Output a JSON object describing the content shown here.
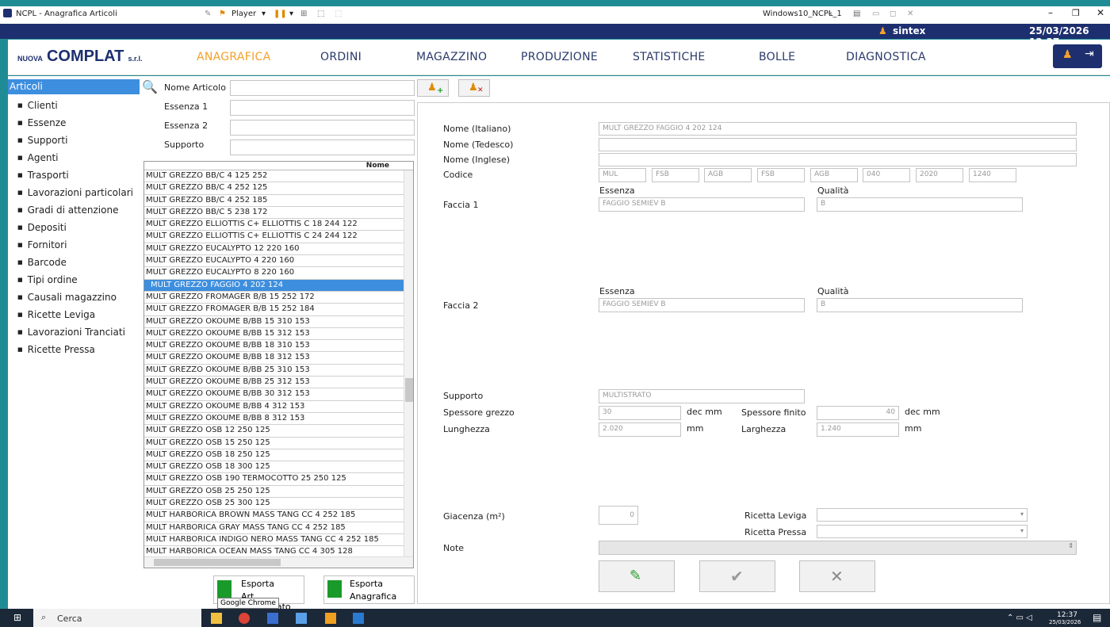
{
  "window": {
    "title": "NCPL - Anagrafica Articoli",
    "vm_name": "Windows10_NCPL_1"
  },
  "player": {
    "label": "Player"
  },
  "header": {
    "user": "sintex",
    "datetime": "25/03/2026 12:37"
  },
  "logo": {
    "prefix": "NUOVA",
    "main": "COMPLAT",
    "suffix": "s.r.l."
  },
  "nav": [
    {
      "label": "ANAGRAFICA",
      "active": true
    },
    {
      "label": "ORDINI"
    },
    {
      "label": "MAGAZZINO"
    },
    {
      "label": "PRODUZIONE"
    },
    {
      "label": "STATISTICHE"
    },
    {
      "label": "BOLLE"
    },
    {
      "label": "DIAGNOSTICA"
    }
  ],
  "sidebar": {
    "active": "Articoli",
    "items": [
      "Clienti",
      "Essenze",
      "Supporti",
      "Agenti",
      "Trasporti",
      "Lavorazioni particolari",
      "Gradi di attenzione",
      "Depositi",
      "Fornitori",
      "Barcode",
      "Tipi ordine",
      "Causali magazzino",
      "Ricette Leviga",
      "Lavorazioni Tranciati",
      "Ricette Pressa"
    ]
  },
  "filters": {
    "nome_articolo": "Nome Articolo",
    "essenza1": "Essenza 1",
    "essenza2": "Essenza 2",
    "supporto": "Supporto"
  },
  "list": {
    "header": "Nome",
    "selected": "MULT GREZZO FAGGIO 4 202 124",
    "rows": [
      "MULT GREZZO BB/C 4 125 252",
      "MULT GREZZO BB/C 4 252 125",
      "MULT GREZZO BB/C 4 252 185",
      "MULT GREZZO BB/C 5 238 172",
      "MULT GREZZO ELLIOTTIS C+ ELLIOTTIS C 18 244 122",
      "MULT GREZZO ELLIOTTIS C+ ELLIOTTIS C 24 244 122",
      "MULT GREZZO EUCALYPTO 12 220 160",
      "MULT GREZZO EUCALYPTO 4 220 160",
      "MULT GREZZO EUCALYPTO 8 220 160",
      "MULT GREZZO FAGGIO 4 202 124",
      "MULT GREZZO FROMAGER B/B 15 252 172",
      "MULT GREZZO FROMAGER B/B 15 252 184",
      "MULT GREZZO OKOUME B/BB 15 310 153",
      "MULT GREZZO OKOUME B/BB 15 312 153",
      "MULT GREZZO OKOUME B/BB 18 310 153",
      "MULT GREZZO OKOUME B/BB 18 312 153",
      "MULT GREZZO OKOUME B/BB 25 310 153",
      "MULT GREZZO OKOUME B/BB 25 312 153",
      "MULT GREZZO OKOUME B/BB 30 312 153",
      "MULT GREZZO OKOUME B/BB 4 312 153",
      "MULT GREZZO OKOUME B/BB 8 312 153",
      "MULT GREZZO OSB 12 250 125",
      "MULT GREZZO OSB 15 250 125",
      "MULT GREZZO OSB 18 250 125",
      "MULT GREZZO OSB 18 300 125",
      "MULT GREZZO OSB 190 TERMOCOTTO 25 250 125",
      "MULT GREZZO OSB 25 250 125",
      "MULT GREZZO OSB 25 300 125",
      "MULT HARBORICA BROWN MASS TANG CC 4 252 185",
      "MULT HARBORICA GRAY MASS TANG CC 4 252 185",
      "MULT HARBORICA INDIGO NERO MASS TANG CC 4 252 185",
      "MULT HARBORICA OCEAN MASS TANG CC 4 305 128"
    ]
  },
  "export": {
    "selected_line1": "Esporta",
    "selected_line2": "Art. selezionato",
    "all_line1": "Esporta",
    "all_line2": "Anagrafica",
    "tooltip": "Google Chrome"
  },
  "detail": {
    "nome_it_label": "Nome (Italiano)",
    "nome_it": "MULT GREZZO FAGGIO 4 202 124",
    "nome_de_label": "Nome (Tedesco)",
    "nome_de": "",
    "nome_en_label": "Nome (Inglese)",
    "nome_en": "",
    "codice_label": "Codice",
    "codice": [
      "MUL",
      "FSB",
      "AGB",
      "FSB",
      "AGB",
      "040",
      "2020",
      "1240"
    ],
    "essenza_label": "Essenza",
    "qualita_label": "Qualità",
    "faccia1_label": "Faccia 1",
    "faccia1_essenza": "FAGGIO SEMIEV B",
    "faccia1_qualita": "B",
    "faccia2_label": "Faccia 2",
    "faccia2_essenza": "FAGGIO SEMIEV B",
    "faccia2_qualita": "B",
    "supporto_label": "Supporto",
    "supporto": "MULTISTRATO",
    "spessore_grezzo_label": "Spessore grezzo",
    "spessore_grezzo": "30",
    "dec_mm": "dec mm",
    "spessore_finito_label": "Spessore finito",
    "spessore_finito": "40",
    "lunghezza_label": "Lunghezza",
    "lunghezza": "2.020",
    "mm": "mm",
    "larghezza_label": "Larghezza",
    "larghezza": "1.240",
    "giacenza_label": "Giacenza (m²)",
    "giacenza": "0",
    "ricetta_leviga_label": "Ricetta Leviga",
    "ricetta_pressa_label": "Ricetta Pressa",
    "note_label": "Note"
  },
  "taskbar": {
    "search": "Cerca",
    "time": "12:37",
    "date": "25/03/2026"
  }
}
